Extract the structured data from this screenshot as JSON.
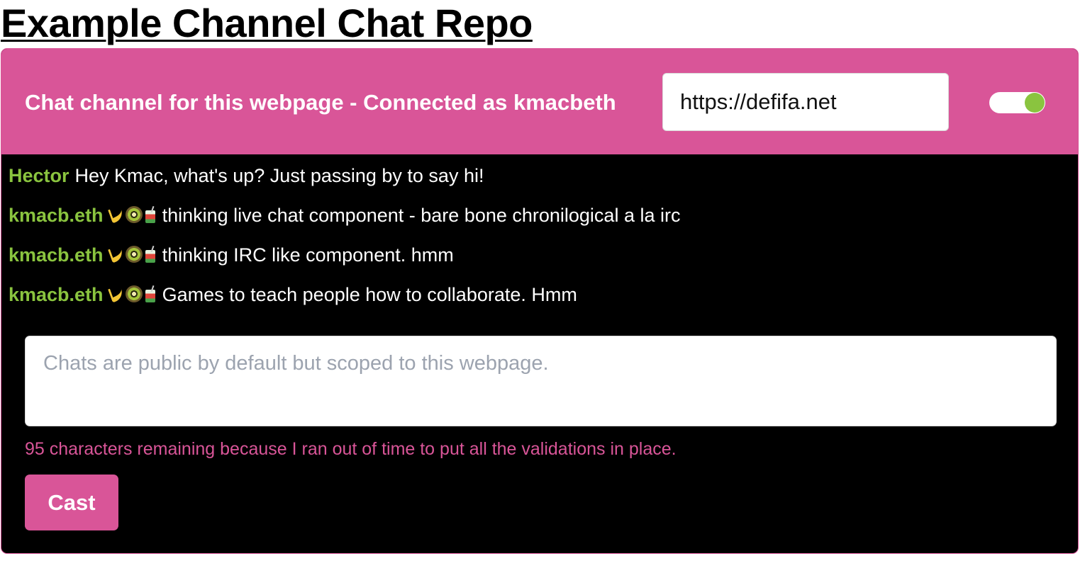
{
  "page": {
    "title": "Example Channel Chat Repo"
  },
  "header": {
    "label": "Chat channel for this webpage - Connected as kmacbeth",
    "url_value": "https://defifa.net",
    "toggle_on": true
  },
  "messages": [
    {
      "author": "Hector",
      "emoji": [],
      "text": "Hey Kmac, what's up? Just passing by to say hi!"
    },
    {
      "author": "kmacb.eth",
      "emoji": [
        "banana-icon",
        "kiwi-icon",
        "drink-icon"
      ],
      "text": "thinking live chat component - bare bone chronilogical a la irc"
    },
    {
      "author": "kmacb.eth",
      "emoji": [
        "banana-icon",
        "kiwi-icon",
        "drink-icon"
      ],
      "text": "thinking IRC like component. hmm"
    },
    {
      "author": "kmacb.eth",
      "emoji": [
        "banana-icon",
        "kiwi-icon",
        "drink-icon"
      ],
      "text": "Games to teach people how to collaborate. Hmm"
    }
  ],
  "composer": {
    "placeholder": "Chats are public by default but scoped to this webpage.",
    "value": "",
    "remaining_note": "95 characters remaining because I ran out of time to put all the validations in place.",
    "cast_label": "Cast"
  },
  "colors": {
    "accent": "#d95598",
    "author": "#8ac43f",
    "toggle_knob": "#8ac43f",
    "chat_background": "#000000"
  }
}
